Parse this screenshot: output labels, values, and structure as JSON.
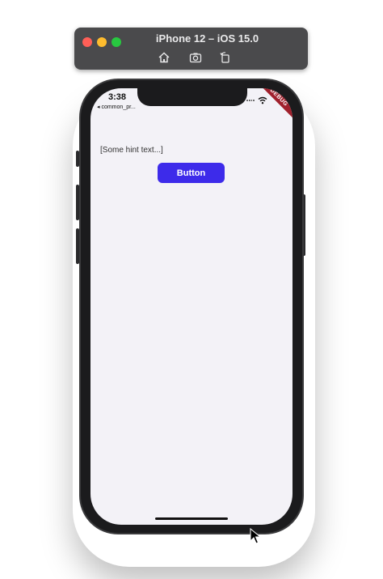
{
  "simulator": {
    "title": "iPhone 12 – iOS 15.0",
    "controls": {
      "home_icon": "home-icon",
      "screenshot_icon": "camera-icon",
      "rotate_icon": "rotate-icon"
    },
    "traffic_colors": {
      "close": "#ff5f57",
      "minimize": "#febc2e",
      "zoom": "#28c840"
    }
  },
  "status_bar": {
    "time": "3:38",
    "back_label": "◂ common_pr...",
    "debug_banner": "DEBUG"
  },
  "content": {
    "hint_text": "[Some hint text...]",
    "button_label": "Button",
    "button_color": "#3d2bea"
  }
}
